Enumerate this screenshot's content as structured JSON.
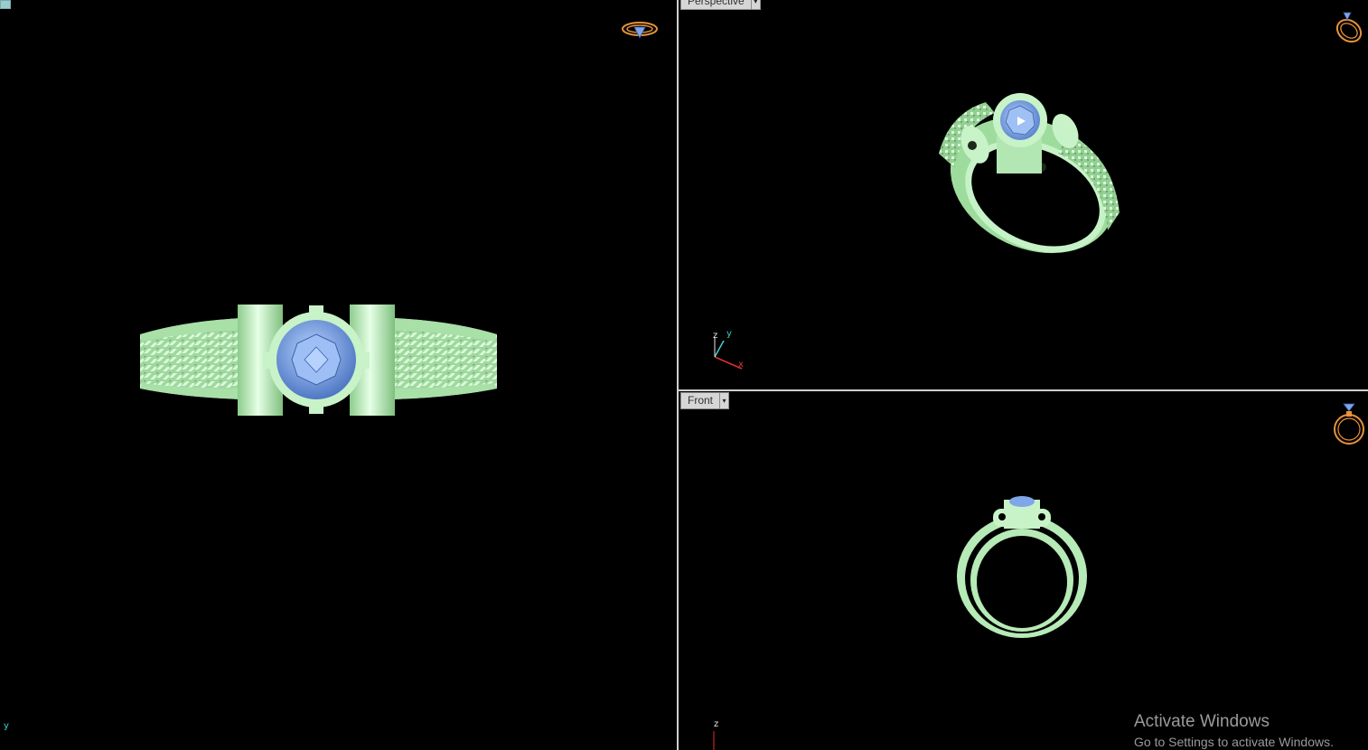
{
  "viewports": {
    "top": {
      "axis_label": "y"
    },
    "perspective": {
      "label": "Perspective",
      "axis_x": "x",
      "axis_y": "y",
      "axis_z": "z"
    },
    "front": {
      "label": "Front",
      "axis_z": "z"
    }
  },
  "icons": {
    "top_nav": "ring-top-view-icon",
    "perspective_nav": "ring-perspective-icon",
    "front_nav": "ring-front-view-icon"
  },
  "colors": {
    "background": "#000000",
    "metal": "#b6eab6",
    "gem": "#7ea6e8",
    "nav_icon": "#e8923a",
    "axis_x": "#e0302a",
    "axis_y": "#3fd0d0",
    "axis_z": "#e8e8e8"
  },
  "watermark": {
    "title": "Activate Windows",
    "subtitle": "Go to Settings to activate Windows."
  }
}
